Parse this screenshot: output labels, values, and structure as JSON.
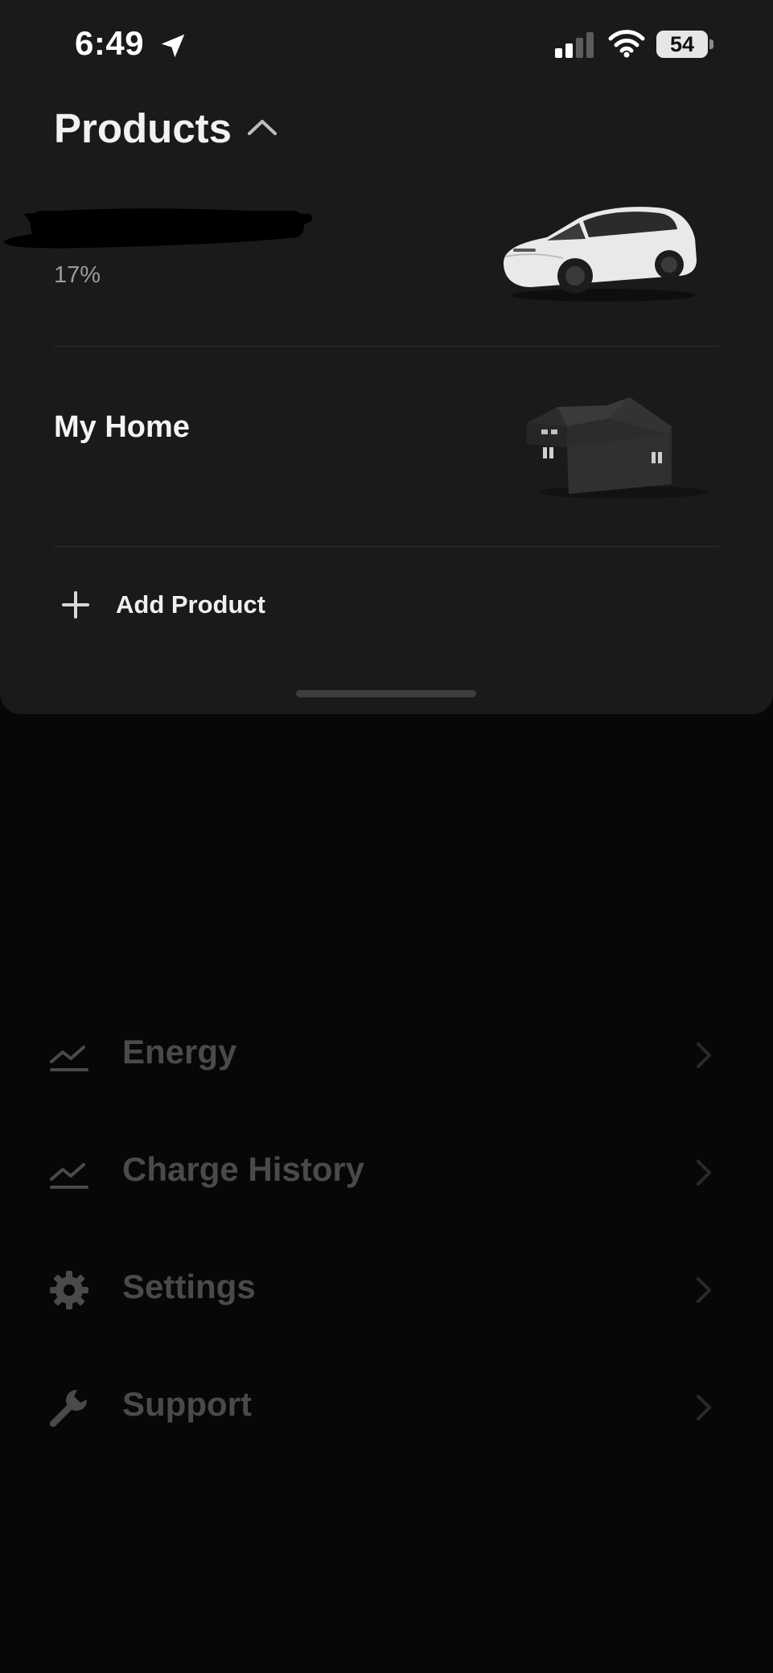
{
  "status_bar": {
    "time": "6:49",
    "battery_level": "54",
    "icons": [
      "location-arrow-icon",
      "cellular-signal-icon",
      "wifi-icon",
      "battery-icon"
    ]
  },
  "products_sheet": {
    "title": "Products",
    "title_icon": "chevron-up-icon",
    "vehicle": {
      "name_redacted": true,
      "charge_percent": "17%",
      "image": "white-suv-image"
    },
    "home": {
      "label": "My Home",
      "image": "house-image"
    },
    "add_product": {
      "icon": "plus-icon",
      "label": "Add Product"
    }
  },
  "menu": {
    "items": [
      {
        "label": "Energy",
        "icon": "chart-line-icon"
      },
      {
        "label": "Charge History",
        "icon": "chart-line-icon"
      },
      {
        "label": "Settings",
        "icon": "gear-icon"
      },
      {
        "label": "Support",
        "icon": "wrench-icon"
      }
    ]
  },
  "colors": {
    "background": "#070707",
    "sheet": "#1a1a1a",
    "menu_text": "#4a4a4a",
    "secondary_text": "#9c9c9c"
  }
}
